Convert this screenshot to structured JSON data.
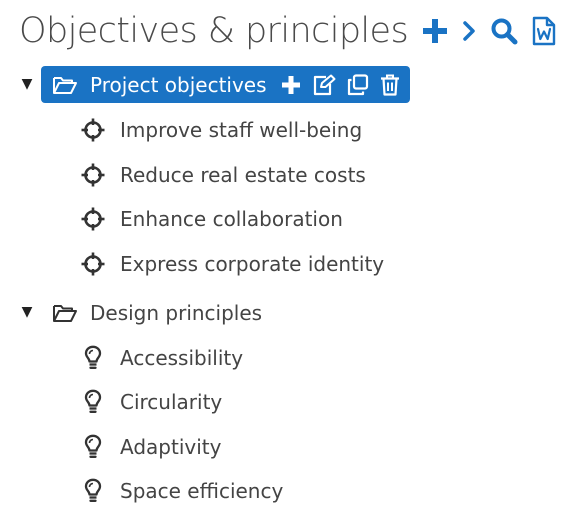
{
  "header": {
    "title": "Objectives & principles",
    "actions": [
      {
        "icon": "plus-icon"
      },
      {
        "icon": "chevron-right-icon"
      },
      {
        "icon": "search-icon"
      },
      {
        "icon": "word-document-icon"
      }
    ]
  },
  "colors": {
    "accent": "#1a73c4",
    "text": "#444444",
    "title": "#4a4a4a"
  },
  "tree": {
    "groups": [
      {
        "label": "Project objectives",
        "expanded": true,
        "selected": true,
        "icon": "open-folder-icon",
        "row_actions": [
          "plus-icon",
          "edit-icon",
          "copy-icon",
          "trash-icon"
        ],
        "item_icon": "crosshair-icon",
        "items": [
          {
            "label": "Improve staff well-being"
          },
          {
            "label": "Reduce real estate costs"
          },
          {
            "label": "Enhance collaboration"
          },
          {
            "label": "Express corporate identity"
          }
        ]
      },
      {
        "label": "Design principles",
        "expanded": true,
        "selected": false,
        "icon": "open-folder-icon",
        "item_icon": "lightbulb-icon",
        "items": [
          {
            "label": "Accessibility"
          },
          {
            "label": "Circularity"
          },
          {
            "label": "Adaptivity"
          },
          {
            "label": "Space efficiency"
          }
        ]
      }
    ]
  }
}
